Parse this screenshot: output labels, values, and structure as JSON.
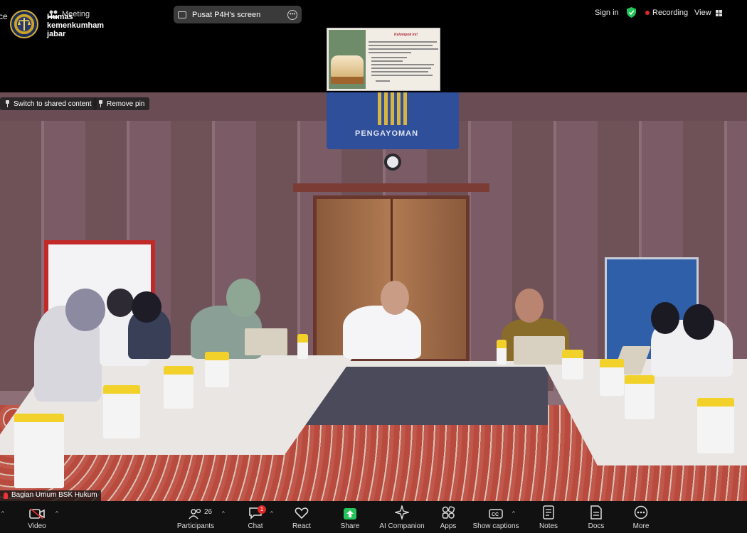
{
  "app": {
    "left_edge_text": "ce",
    "meeting_label": "Meeting",
    "host_name": "Humas kemenkumham jabar",
    "share_pill_label": "Pusat P4H's screen",
    "sign_in": "Sign in",
    "recording": "Recording",
    "view": "View"
  },
  "shared_screen": {
    "slide_title": "Kelompok Ini!"
  },
  "video": {
    "switch_btn": "Switch to shared content",
    "remove_pin_btn": "Remove pin",
    "wall_sign": "PENGAYOMAN",
    "participant_name": "Bagian Umum BSK Hukum"
  },
  "toolbar": {
    "left_fragment": "",
    "video": "Video",
    "participants": "Participants",
    "participants_count": "26",
    "chat": "Chat",
    "chat_badge": "1",
    "react": "React",
    "share": "Share",
    "ai_companion": "AI Companion",
    "apps": "Apps",
    "show_captions": "Show captions",
    "notes": "Notes",
    "docs": "Docs",
    "more": "More"
  },
  "colors": {
    "recording_dot": "#e02828",
    "shield": "#23c45a",
    "share_button": "#23c45a",
    "wall_emblem": "#2f4f9a"
  }
}
